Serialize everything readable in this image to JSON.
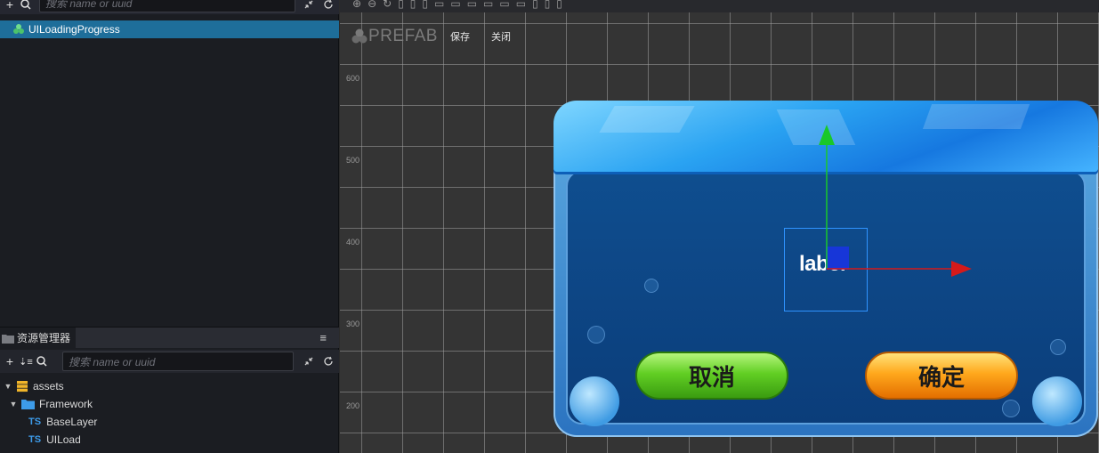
{
  "hierarchy": {
    "search_placeholder": "搜索 name or uuid",
    "selected_node": "UILoadingProgress"
  },
  "assets": {
    "tab_title": "资源管理器",
    "search_placeholder": "搜索 name or uuid",
    "tree": [
      {
        "label": "assets",
        "level": 0,
        "type": "db"
      },
      {
        "label": "Framework",
        "level": 1,
        "type": "folder"
      },
      {
        "label": "BaseLayer",
        "level": 2,
        "type": "ts"
      },
      {
        "label": "UILoad",
        "level": 2,
        "type": "ts"
      }
    ],
    "ts_badge": "TS"
  },
  "scene": {
    "prefab_label": "PREFAB",
    "save_label": "保存",
    "close_label": "关闭",
    "axis_labels": [
      "600",
      "500",
      "400",
      "300",
      "200"
    ]
  },
  "dialog": {
    "label_text": "label",
    "cancel_label": "取消",
    "confirm_label": "确定"
  },
  "colors": {
    "selection": "#1e6e9a",
    "accent": "#3d9be9"
  }
}
